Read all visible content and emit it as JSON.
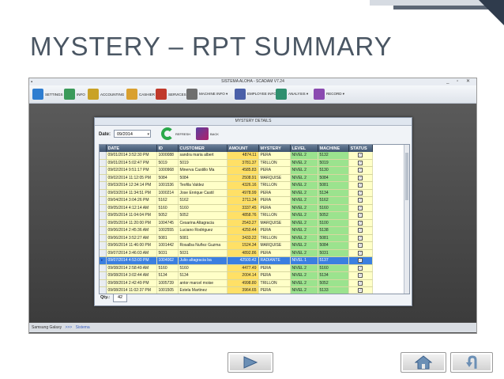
{
  "slide_title": "MYSTERY – RPT SUMMARY",
  "app": {
    "window_title": "SISTEMA ALOHA - SCADAM V7.24",
    "window_controls": "_ ▫ ✕",
    "menu": [
      {
        "label": "SETTINGS",
        "icon": "settings-icon"
      },
      {
        "label": "INFO",
        "icon": "info-icon"
      },
      {
        "label": "ACCOUNTING",
        "icon": "accounting-icon"
      },
      {
        "label": "CASHIER",
        "icon": "cashier-icon"
      },
      {
        "label": "SERVICES",
        "icon": "services-icon"
      },
      {
        "label": "MACHINE INFO ▾",
        "icon": "machine-icon"
      },
      {
        "label": "EMPLOYEE INFO ▾",
        "icon": "employee-icon"
      },
      {
        "label": "ANALYSIS ▾",
        "icon": "analysis-icon"
      },
      {
        "label": "RECORD ▾",
        "icon": "record-icon"
      }
    ],
    "status_left": "Samsung Galaxy",
    "status_sep": ">>>",
    "status_right": "Sistema"
  },
  "dialog": {
    "title": "MYSTERY DETAILS",
    "date_label": "Date:",
    "date_value": "09/2014",
    "refresh_label": "REFRESH",
    "back_label": "BACK",
    "qty_label": "Qty.:",
    "qty_value": "42"
  },
  "table": {
    "headers": [
      "DATE",
      "ID",
      "CUSTOMER",
      "AMOUNT",
      "MYSTERY",
      "LEVEL",
      "MACHINE",
      "STATUS"
    ],
    "rows": [
      [
        "09/01/2014 3:52:30 PM",
        "1000088",
        "sandra maria albert",
        "4874.11",
        "PERA",
        "NIVEL 2",
        "5132",
        "✓"
      ],
      [
        "09/01/2014 5:02:47 PM",
        "5019",
        "5019",
        "3781.37",
        "TRILLON",
        "NIVEL 2",
        "5019",
        "✓"
      ],
      [
        "09/02/2014 9:51:17 PM",
        "1000968",
        "Minerva Castillo Ma",
        "4585.83",
        "PERA",
        "NIVEL 2",
        "5130",
        "✓"
      ],
      [
        "09/02/2014 11:12:05 PM",
        "5084",
        "5084",
        "2508.91",
        "MARQUISE",
        "NIVEL 2",
        "5084",
        "✓"
      ],
      [
        "09/03/2014 12:34:14 PM",
        "1001536",
        "Teofila Valdez",
        "4326.16",
        "TRILLON",
        "NIVEL 2",
        "5081",
        "✓"
      ],
      [
        "09/03/2014 11:34:51 PM",
        "1000214",
        "Jose Enrique Castil",
        "4978.99",
        "PERA",
        "NIVEL 2",
        "5134",
        "✓"
      ],
      [
        "09/04/2014 3:04:26 PM",
        "5162",
        "5162",
        "2711.24",
        "PERA",
        "NIVEL 2",
        "5162",
        "✓"
      ],
      [
        "09/05/2014 4:12:14 AM",
        "5160",
        "5160",
        "3337.45",
        "PERA",
        "NIVEL 2",
        "5160",
        "✓"
      ],
      [
        "09/05/2014 11:04:04 PM",
        "5052",
        "5052",
        "4858.76",
        "TRILLON",
        "NIVEL 2",
        "5052",
        "✓"
      ],
      [
        "09/05/2014 11:20:00 PM",
        "1004745",
        "Cesarina Altagracia",
        "2543.27",
        "MARQUISE",
        "NIVEL 2",
        "5100",
        "✓"
      ],
      [
        "09/06/2014 2:45:36 AM",
        "1002555",
        "Luciano Rodriguez",
        "4250.44",
        "PERA",
        "NIVEL 2",
        "5138",
        "✓"
      ],
      [
        "09/06/2014 3:52:27 AM",
        "5081",
        "5081",
        "3433.22",
        "TRILLON",
        "NIVEL 2",
        "5081",
        "✓"
      ],
      [
        "09/06/2014 11:46:00 PM",
        "1001442",
        "Rosalba Nuñez Guzma",
        "1524.34",
        "MARQUISE",
        "NIVEL 2",
        "5084",
        "✓"
      ],
      [
        "09/07/2014 3:46:03 AM",
        "5031",
        "5031",
        "4892.86",
        "PERA",
        "NIVEL 2",
        "5031",
        "✓"
      ],
      [
        "09/07/2014 4:53:00 PM",
        "1004062",
        "Julio altagracia ba",
        "42500.42",
        "RADIANTE",
        "NIVEL 1",
        "5137",
        "✓"
      ],
      [
        "09/08/2014 2:58:49 AM",
        "5160",
        "5160",
        "4477.49",
        "PERA",
        "NIVEL 2",
        "5160",
        "✓"
      ],
      [
        "09/08/2014 3:02:44 AM",
        "5134",
        "5134",
        "2004.14",
        "PERA",
        "NIVEL 2",
        "5134",
        "✓"
      ],
      [
        "09/08/2014 2:42:49 PM",
        "1005739",
        "antor marcel moise",
        "4998.80",
        "TRILLON",
        "NIVEL 2",
        "5052",
        "✓"
      ],
      [
        "09/08/2014 11:02:37 PM",
        "1001505",
        "Estela Martinez",
        "3964.65",
        "PERA",
        "NIVEL 2",
        "5133",
        "✓"
      ],
      [
        "09/08/2014 11:07:52 PM",
        "5132",
        "5132",
        "2007.25",
        "PERA",
        "NIVEL 2",
        "5132",
        "✓"
      ],
      [
        "09/09/2014 3:53:42 PM",
        "1000038",
        "Gladys Josefina Nuñ",
        "9989.99",
        "OVAL",
        "NIVEL 1",
        "5066",
        "✓"
      ],
      [
        "09/09/2014 10:11:19 PM",
        "1000968",
        "Minerva Castillo Ma",
        "3868.62",
        "PERA",
        "NIVEL 2",
        "5130",
        "✓"
      ]
    ],
    "selected_row_index": 14
  },
  "colors": {
    "amount_cell": "#ffe066",
    "level_machine_cell": "#9be38e",
    "row_background": "#ffffc8",
    "selected_row": "#3b7fe0",
    "header": "#4f6581"
  },
  "nav": {
    "next_icon": "play-arrow-icon",
    "home_icon": "home-icon",
    "return_icon": "return-arrow-icon"
  }
}
